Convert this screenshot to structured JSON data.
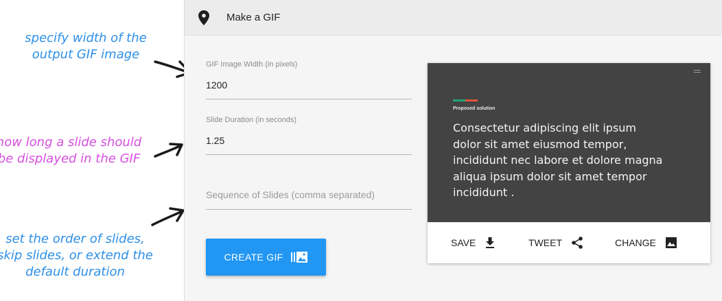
{
  "annotations": {
    "width_note_line1": "specify width of the",
    "width_note_line2": "output GIF image",
    "duration_note_line1": "how long a slide should",
    "duration_note_line2": "be displayed in the GIF",
    "order_note_line1": "set the order of slides,",
    "order_note_line2": "skip slides, or extend the",
    "order_note_line3": "default duration",
    "colors": {
      "blue": "#2e8fe8",
      "pink": "#d64fe0"
    }
  },
  "header": {
    "title": "Make a GIF",
    "icon": "location-pin-icon"
  },
  "form": {
    "width_label": "GIF Image Width (in pixels)",
    "width_value": "1200",
    "duration_label": "Slide Duration (in seconds)",
    "duration_value": "1.25",
    "sequence_placeholder": "Sequence of Slides (comma separated)",
    "create_label": "CREATE GIF",
    "create_icon": "gif-slides-icon",
    "accent_color": "#2196f3"
  },
  "preview": {
    "tag": "Proposed solution",
    "body": "Consectetur adipiscing elit ipsum dolor sit amet eiusmod tempor, incididunt nec labore et dolore magna aliqua ipsum dolor sit amet tempor incididunt .",
    "actions": {
      "save": "SAVE",
      "tweet": "TWEET",
      "change": "CHANGE"
    }
  }
}
